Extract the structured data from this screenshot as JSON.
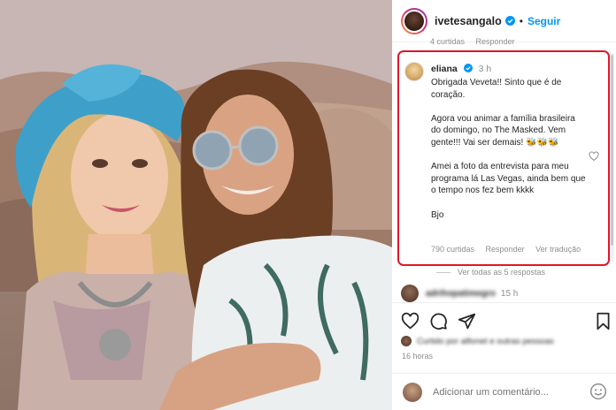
{
  "post": {
    "username": "ivetesangalo",
    "follow_label": "Seguir",
    "separator": "•"
  },
  "previous_comment": {
    "likes": "4 curtidas",
    "reply": "Responder"
  },
  "highlighted_comment": {
    "username": "eliana",
    "time": "3 h",
    "paragraphs": [
      "Obrigada Veveta!! Sinto que é de coração.",
      "Agora vou animar a família brasileira do domingo, no The Masked. Vem gente!!! Vai ser demais! 🐝🐝🐝",
      "Amei a foto da entrevista para meu programa lá Las Vegas, ainda bem que o tempo nos fez bem kkkk",
      "Bjo"
    ],
    "likes": "790 curtidas",
    "reply": "Responder",
    "translate": "Ver tradução"
  },
  "view_replies": "Ver todas as 5 respostas",
  "next_comment": {
    "username": "adrihopatimegro",
    "time": "15 h"
  },
  "liked_by": "Curtido por alltvnet e outras pessoas",
  "post_time": "16 horas",
  "add_comment": {
    "placeholder": "Adicionar um comentário..."
  },
  "colors": {
    "accent": "#0095f6",
    "highlight_border": "#e0162b",
    "verified": "#0095f6"
  },
  "icons": {
    "verified": "verified-badge-icon",
    "heart": "heart-icon",
    "comment": "comment-icon",
    "share": "share-icon",
    "save": "bookmark-icon",
    "emoji": "emoji-icon"
  }
}
